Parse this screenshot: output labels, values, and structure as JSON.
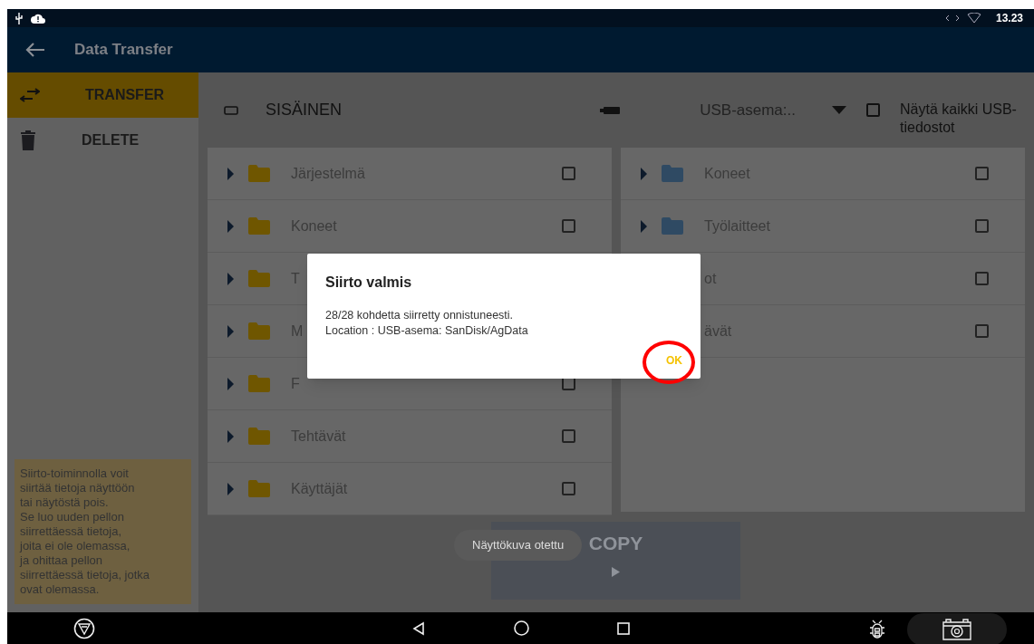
{
  "status_bar": {
    "time": "13.23"
  },
  "app_bar": {
    "title": "Data Transfer"
  },
  "sidebar": {
    "items": [
      {
        "kind": "transfer",
        "label": "TRANSFER",
        "selected": true
      },
      {
        "kind": "delete",
        "label": "DELETE",
        "selected": false
      }
    ],
    "help_text": "Siirto-toiminnolla voit\nsiirtää tietoja näyttöön\ntai näytöstä pois.\nSe luo uuden pellon\nsiirrettäessä tietoja,\njoita ei ole olemassa,\nja ohittaa pellon\nsiirrettäessä tietoja, jotka\novat olemassa."
  },
  "source": {
    "label": "SISÄINEN"
  },
  "destination": {
    "dropdown": "USB-asema:..",
    "show_all": {
      "label": "Näytä kaikki USB-tiedostot",
      "checked": false
    }
  },
  "left_panel": {
    "items": [
      {
        "name": "Järjestelmä",
        "checked": false
      },
      {
        "name": "Koneet",
        "checked": false
      },
      {
        "name": "T"
      },
      {
        "name": "M"
      },
      {
        "name": "F",
        "checked": false
      },
      {
        "name": "Tehtävät",
        "checked": false
      },
      {
        "name": "Käyttäjät",
        "checked": false
      }
    ]
  },
  "right_panel": {
    "items": [
      {
        "name": "Koneet",
        "checked": false
      },
      {
        "name": "Työlaitteet",
        "checked": false
      },
      {
        "name": "ot",
        "checked": false
      },
      {
        "name": "ävät",
        "checked": false
      }
    ]
  },
  "copy_button": {
    "label": "COPY"
  },
  "toast": "Näyttökuva otettu",
  "dialog": {
    "title": "Siirto valmis",
    "message": "28/28 kohdetta siirretty onnistuneesti.\nLocation : USB-asema: SanDisk/AgData",
    "button": "OK"
  }
}
